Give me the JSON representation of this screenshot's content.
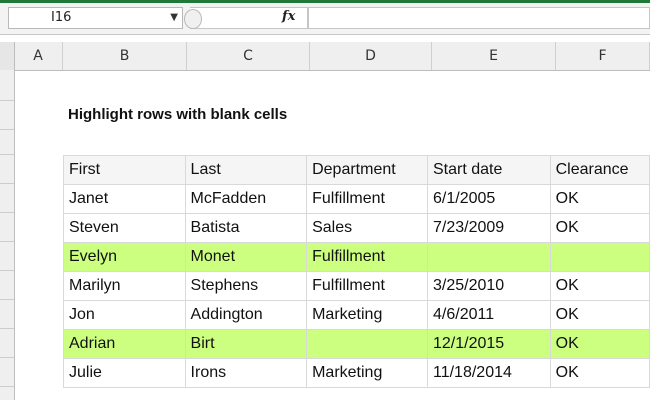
{
  "formula_bar": {
    "name_box": "I16",
    "fx_label": "fx",
    "formula": ""
  },
  "columns": [
    "A",
    "B",
    "C",
    "D",
    "E",
    "F"
  ],
  "sheet": {
    "title": "Highlight rows with blank cells",
    "headers": [
      "First",
      "Last",
      "Department",
      "Start date",
      "Clearance"
    ],
    "rows": [
      {
        "first": "Janet",
        "last": "McFadden",
        "dept": "Fulfillment",
        "date": "6/1/2005",
        "clear": "OK",
        "highlight": false
      },
      {
        "first": "Steven",
        "last": "Batista",
        "dept": "Sales",
        "date": "7/23/2009",
        "clear": "OK",
        "highlight": false
      },
      {
        "first": "Evelyn",
        "last": "Monet",
        "dept": "Fulfillment",
        "date": "",
        "clear": "",
        "highlight": true
      },
      {
        "first": "Marilyn",
        "last": "Stephens",
        "dept": "Fulfillment",
        "date": "3/25/2010",
        "clear": "OK",
        "highlight": false
      },
      {
        "first": "Jon",
        "last": "Addington",
        "dept": "Marketing",
        "date": "4/6/2011",
        "clear": "OK",
        "highlight": false
      },
      {
        "first": "Adrian",
        "last": "Birt",
        "dept": "",
        "date": "12/1/2015",
        "clear": "OK",
        "highlight": true
      },
      {
        "first": "Julie",
        "last": "Irons",
        "dept": "Marketing",
        "date": "11/18/2014",
        "clear": "OK",
        "highlight": false
      }
    ]
  },
  "colors": {
    "highlight": "#ccff80",
    "excel_green": "#1f7a3a"
  }
}
